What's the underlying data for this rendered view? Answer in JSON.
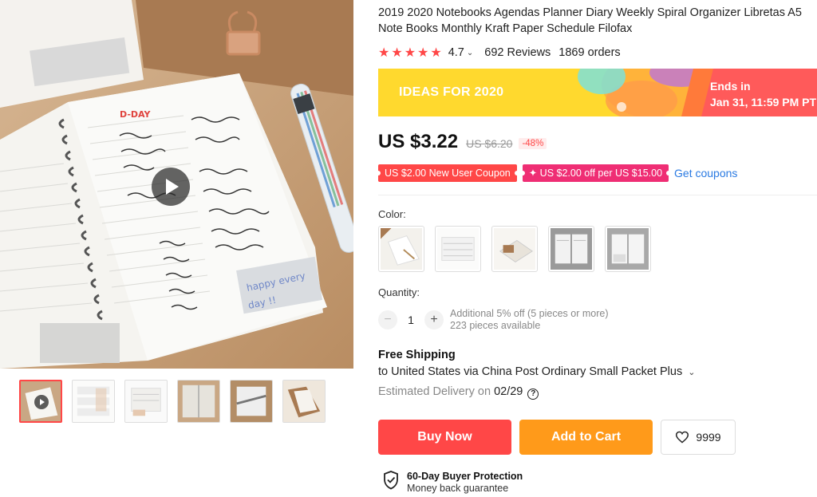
{
  "product": {
    "title": "2019 2020 Notebooks Agendas Planner Diary Weekly Spiral Organizer Libretas A5 Note Books Monthly Kraft Paper Schedule Filofax",
    "rating": "4.7",
    "stars": 5,
    "reviews": "692 Reviews",
    "orders": "1869 orders"
  },
  "promo": {
    "label": "IDEAS FOR 2020",
    "ends_label": "Ends in",
    "ends_value": "Jan 31, 11:59 PM PT"
  },
  "price": {
    "current": "US $3.22",
    "original": "US $6.20",
    "discount": "-48%"
  },
  "coupons": {
    "items": [
      "US $2.00 New User Coupon",
      "✦ US $2.00 off per US $15.00"
    ],
    "link": "Get coupons"
  },
  "color": {
    "label": "Color:",
    "options_count": 5
  },
  "quantity": {
    "label": "Quantity:",
    "value": "1",
    "minus": "−",
    "plus": "+",
    "note_line1": "Additional 5% off (5 pieces or more)",
    "note_line2": "223 pieces available"
  },
  "shipping": {
    "title": "Free Shipping",
    "line": "to United States via China Post Ordinary Small Packet Plus",
    "delivery_prefix": "Estimated Delivery on ",
    "delivery_date": "02/29"
  },
  "actions": {
    "buy": "Buy Now",
    "cart": "Add to Cart",
    "wishlist_count": "9999"
  },
  "protection": {
    "title": "60-Day Buyer Protection",
    "subtitle": "Money back guarantee"
  },
  "image_text": {
    "dday": "D-DAY",
    "happy": "happy every",
    "day": "day !!"
  },
  "colors": {
    "accent_red": "#ff4747",
    "accent_orange": "#ff9a1a",
    "coupon_pink": "#ef2e74",
    "link_blue": "#2a7ae2",
    "banner_yellow": "#ffd92e"
  }
}
